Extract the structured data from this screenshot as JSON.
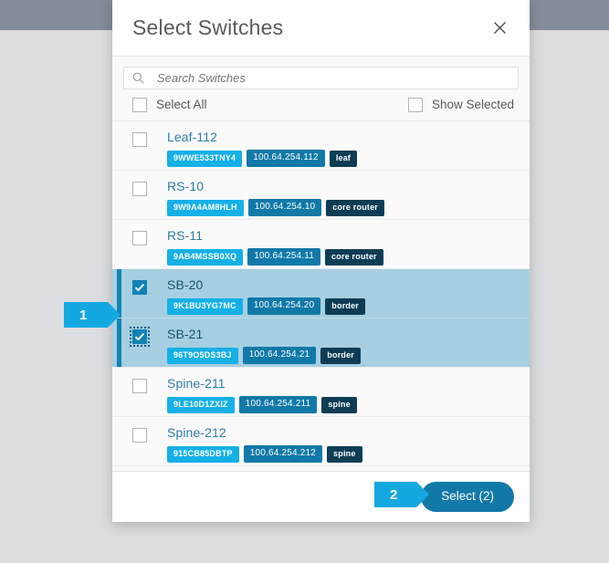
{
  "modal": {
    "title": "Select Switches",
    "close_icon": "close-icon",
    "search": {
      "icon": "search-icon",
      "placeholder": "Search Switches",
      "value": ""
    },
    "toggles": {
      "select_all_label": "Select All",
      "select_all_checked": false,
      "show_selected_label": "Show Selected",
      "show_selected_checked": false
    },
    "switches": [
      {
        "name": "Leaf-112",
        "serial": "9WWE533TNY4",
        "ip": "100.64.254.112",
        "role": "leaf",
        "selected": false
      },
      {
        "name": "RS-10",
        "serial": "9W9A4AM8HLH",
        "ip": "100.64.254.10",
        "role": "core router",
        "selected": false
      },
      {
        "name": "RS-11",
        "serial": "9AB4MSSB0XQ",
        "ip": "100.64.254.11",
        "role": "core router",
        "selected": false
      },
      {
        "name": "SB-20",
        "serial": "9K1BU3YG7MC",
        "ip": "100.64.254.20",
        "role": "border",
        "selected": true
      },
      {
        "name": "SB-21",
        "serial": "96T9O5DS3BJ",
        "ip": "100.64.254.21",
        "role": "border",
        "selected": true
      },
      {
        "name": "Spine-211",
        "serial": "9LE10D1ZXIZ",
        "ip": "100.64.254.211",
        "role": "spine",
        "selected": false
      },
      {
        "name": "Spine-212",
        "serial": "915CB85DBTP",
        "ip": "100.64.254.212",
        "role": "spine",
        "selected": false
      }
    ],
    "footer": {
      "select_button_label": "Select (2)"
    }
  },
  "callouts": [
    {
      "number": "1"
    },
    {
      "number": "2"
    }
  ],
  "colors": {
    "accent_blue": "#13a9e0",
    "button_blue": "#1179a8",
    "serial_badge": "#15b0e6",
    "ip_badge": "#1179a8",
    "role_badge": "#0d3d55",
    "row_selected": "#a6cfe2",
    "row_accent_bar": "#1283b5",
    "topbar": "#848c9c",
    "page_background": "#dcdde0",
    "link_text": "#2f7ea1"
  }
}
